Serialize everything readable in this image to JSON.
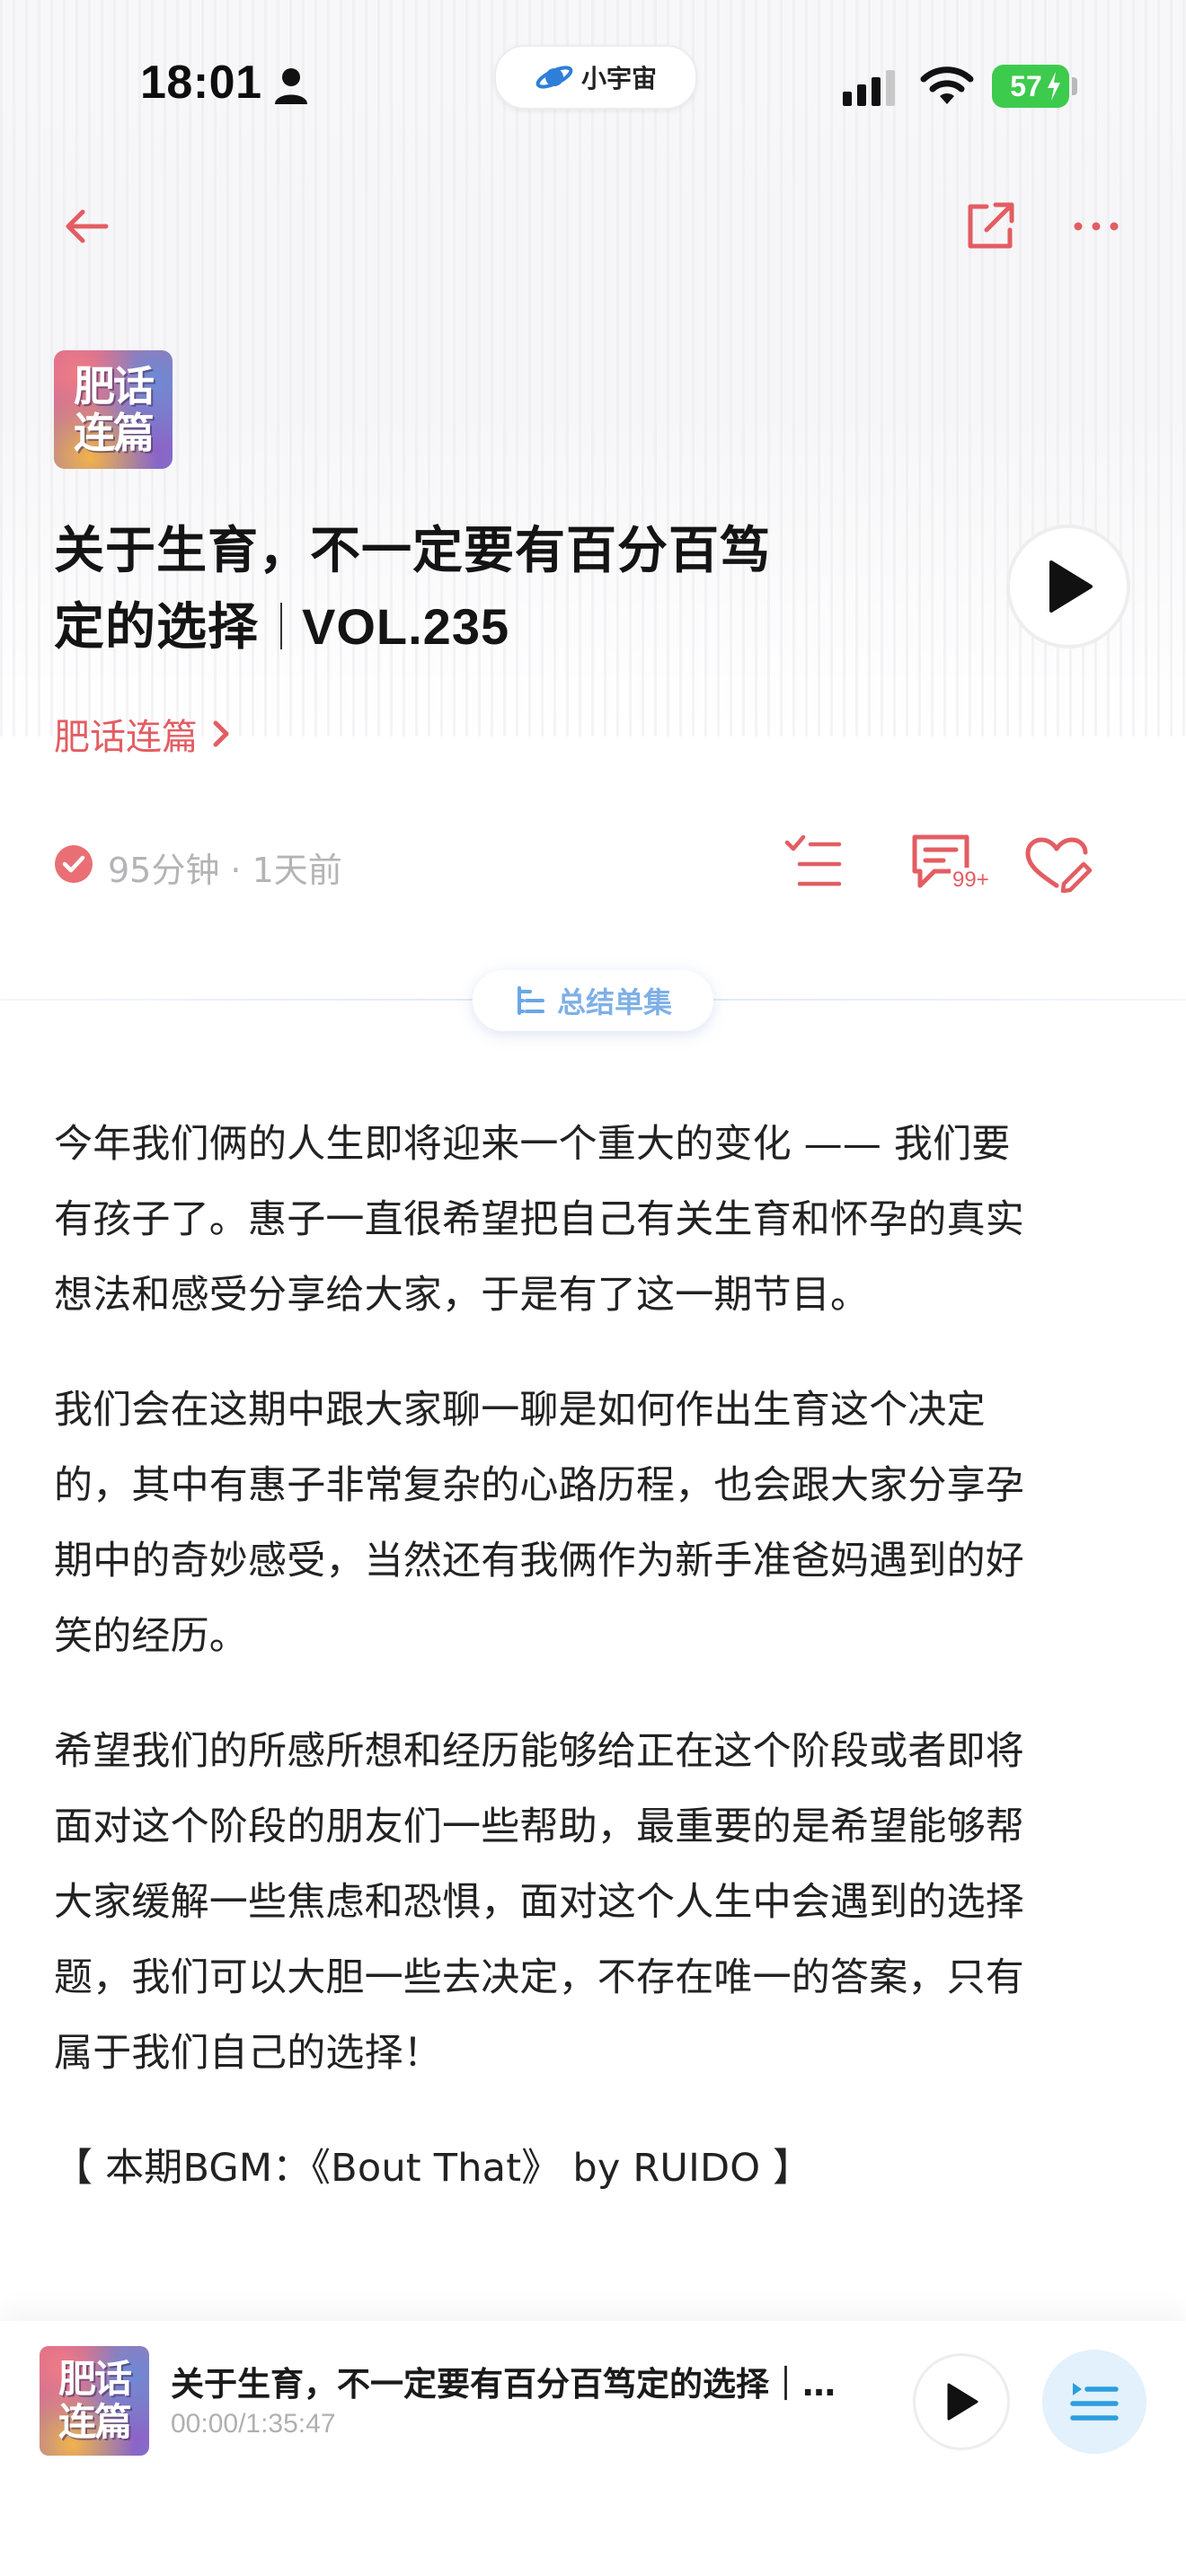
{
  "status_bar": {
    "time": "18:01",
    "app_badge": "小宇宙",
    "battery": "57"
  },
  "podcast": {
    "cover_lines": [
      "肥话",
      "连篇"
    ],
    "name": "肥话连篇"
  },
  "episode": {
    "title_line1": "关于生育，不一定要有百分百笃",
    "title_line2": "定的选择",
    "title_vol": "VOL.235",
    "meta": "95分钟 · 1天前",
    "comment_count": "99+"
  },
  "summary_button": {
    "label": "总结单集"
  },
  "description": {
    "paragraphs": [
      [
        "今年我们俩的人生即将迎来一个重大的变化 —— 我们要",
        "有孩子了。惠子一直很希望把自己有关生育和怀孕的真实",
        "想法和感受分享给大家，于是有了这一期节目。"
      ],
      [
        "我们会在这期中跟大家聊一聊是如何作出生育这个决定",
        "的，其中有惠子非常复杂的心路历程，也会跟大家分享孕",
        "期中的奇妙感受，当然还有我俩作为新手准爸妈遇到的好",
        "笑的经历。"
      ],
      [
        "希望我们的所感所想和经历能够给正在这个阶段或者即将",
        "面对这个阶段的朋友们一些帮助，最重要的是希望能够帮",
        "大家缓解一些焦虑和恐惧，面对这个人生中会遇到的选择",
        "题，我们可以大胆一些去决定，不存在唯一的答案，只有",
        "属于我们自己的选择！"
      ],
      [
        "【 本期BGM：《Bout That》 by RUIDO 】"
      ]
    ]
  },
  "mini_player": {
    "title": "关于生育，不一定要有百分百笃定的选择｜…",
    "time": "00:00/1:35:47"
  },
  "colors": {
    "accent": "#e35d62",
    "summary_blue": "#7fb0e6",
    "battery_green": "#3ccb4d"
  },
  "icons": [
    "person-icon",
    "planet-icon",
    "signal-icon",
    "wifi-icon",
    "bolt-icon",
    "back-arrow-icon",
    "share-icon",
    "more-icon",
    "play-icon",
    "chevron-right-icon",
    "check-circle-icon",
    "playlist-add-icon",
    "comment-icon",
    "like-edit-icon",
    "summary-icon",
    "playlist-icon"
  ]
}
